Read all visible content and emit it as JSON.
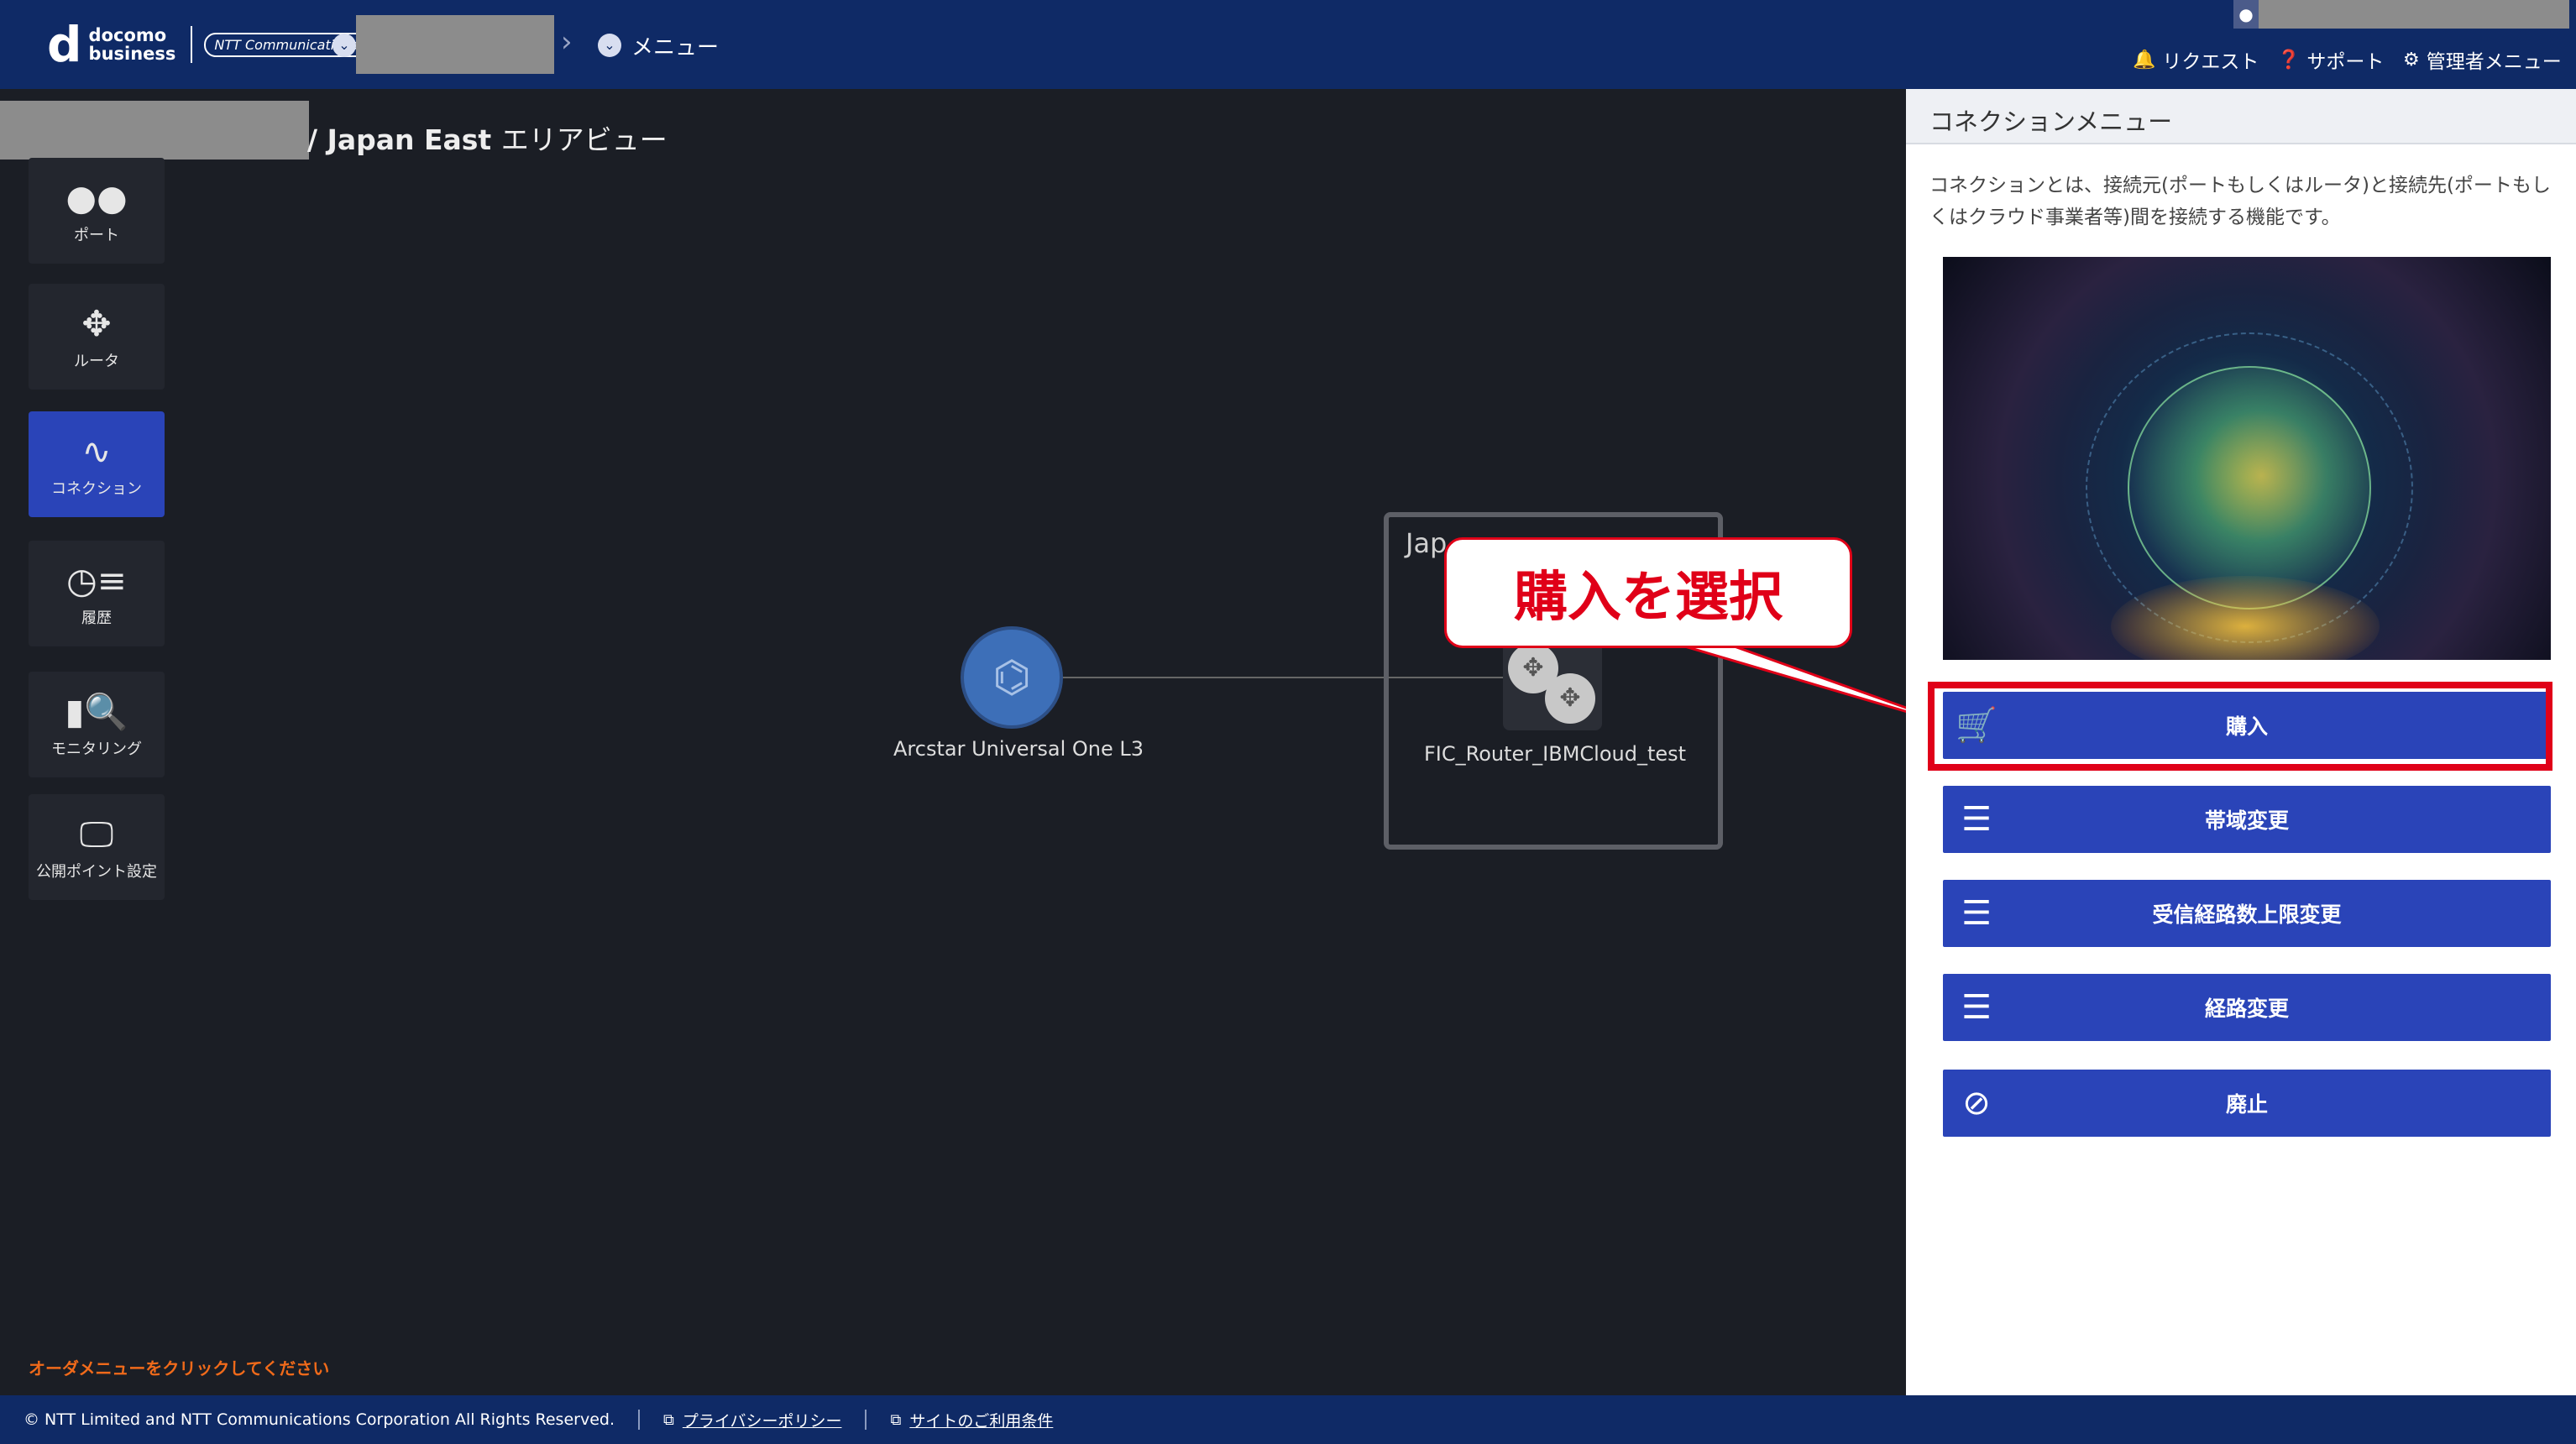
{
  "header": {
    "logo_brand": "d",
    "logo_line1": "docomo",
    "logo_line2": "business",
    "logo_partner": "NTT Communications",
    "breadcrumb_menu": "メニュー",
    "nav": {
      "request": "リクエスト",
      "support": "サポート",
      "admin_menu": "管理者メニュー"
    }
  },
  "sidebar": {
    "items": [
      {
        "label": "ポート",
        "icon": "port-icon"
      },
      {
        "label": "ルータ",
        "icon": "router-icon"
      },
      {
        "label": "コネクション",
        "icon": "connection-icon",
        "active": true
      },
      {
        "label": "履歴",
        "icon": "history-icon"
      },
      {
        "label": "モニタリング",
        "icon": "monitoring-icon"
      },
      {
        "label": "公開ポイント設定",
        "icon": "public-point-icon"
      }
    ]
  },
  "main": {
    "title_sep": "/",
    "title_area": "Japan East",
    "title_suffix": "エリアビュー",
    "order_hint": "オーダメニューをクリックしてください"
  },
  "diagram": {
    "node_left_label": "Arcstar Universal One L3",
    "region_label": "Jap",
    "router_label": "FIC_Router_IBMCloud_test"
  },
  "callout": {
    "text": "購入を選択"
  },
  "panel": {
    "title": "コネクションメニュー",
    "description": "コネクションとは、接続元(ポートもしくはルータ)と接続先(ポートもしくはクラウド事業者等)間を接続する機能です。",
    "buttons": [
      {
        "label": "購入",
        "icon": "cart-download-icon"
      },
      {
        "label": "帯域変更",
        "icon": "sliders-icon"
      },
      {
        "label": "受信経路数上限変更",
        "icon": "sliders-icon"
      },
      {
        "label": "経路変更",
        "icon": "sliders-icon"
      },
      {
        "label": "廃止",
        "icon": "prohibit-icon"
      }
    ]
  },
  "footer": {
    "copyright": "© NTT Limited and NTT Communications Corporation All Rights Reserved.",
    "privacy": "プライバシーポリシー",
    "terms": "サイトのご利用条件"
  },
  "colors": {
    "header_bg": "#0f2a66",
    "accent_blue": "#2a44b8",
    "highlight_red": "#e00018",
    "hint_orange": "#f06a1a"
  }
}
